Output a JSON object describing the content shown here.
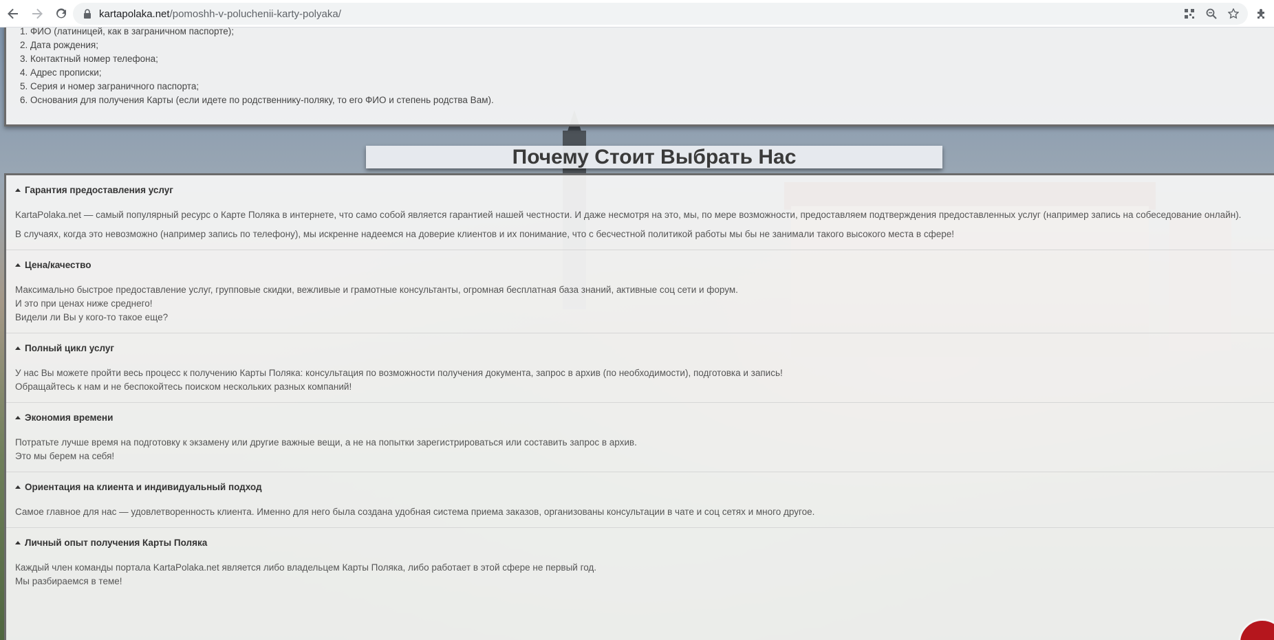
{
  "browser": {
    "url_domain": "kartapolaka.net",
    "url_path": "/pomoshh-v-poluchenii-karty-polyaka/"
  },
  "requirements": [
    "1. ФИО (латиницей, как в заграничном паспорте);",
    "2. Дата рождения;",
    "3. Контактный номер телефона;",
    "4. Адрес прописки;",
    "5. Серия и номер заграничного паспорта;",
    "6. Основания для получения Карты (если идете по родственнику-поляку, то его ФИО и степень родства Вам)."
  ],
  "section_title": "Почему Стоит Выбрать Нас",
  "accordion": [
    {
      "title": "Гарантия предоставления услуг",
      "paragraphs": [
        "KartaPolaka.net — самый популярный ресурс о Карте Поляка в интернете, что само собой является гарантией нашей честности. И даже несмотря на это, мы, по мере возможности, предоставляем подтверждения предоставленных услуг (например запись на собеседование онлайн).",
        "В случаях, когда это невозможно (например запись по телефону), мы искренне надеемся на доверие клиентов и их понимание, что с бесчестной политикой работы мы бы не занимали такого высокого места в сфере!"
      ]
    },
    {
      "title": "Цена/качество",
      "paragraphs": [
        "Максимально быстрое предоставление услуг, групповые скидки, вежливые и грамотные консультанты, огромная бесплатная база знаний, активные соц сети и форум.",
        "И это при ценах ниже среднего!",
        "Видели ли Вы у кого-то такое еще?"
      ]
    },
    {
      "title": "Полный цикл услуг",
      "paragraphs": [
        "У нас Вы можете пройти весь процесс к получению Карты Поляка: консультация по возможности получения документа, запрос в архив (по необходимости), подготовка и запись!",
        "Обращайтесь к нам и не беспокойтесь поиском нескольких разных компаний!"
      ]
    },
    {
      "title": "Экономия времени",
      "paragraphs": [
        "Потратьте лучше время на подготовку к экзамену или другие важные вещи, а не на попытки зарегистрироваться или составить запрос в архив.",
        "Это мы берем на себя!"
      ]
    },
    {
      "title": "Ориентация на клиента и индивидуальный подход",
      "paragraphs": [
        "Самое главное для нас — удовлетворенность клиента. Именно для него была создана удобная система приема заказов, организованы консультации в чате и соц сетях и много другое."
      ]
    },
    {
      "title": "Личный опыт получения Карты Поляка",
      "paragraphs": [
        "Каждый член команды портала KartaPolaka.net является либо владельцем Карты Поляка, либо работает в этой сфере не первый год.",
        "Мы разбираемся в теме!"
      ]
    }
  ]
}
